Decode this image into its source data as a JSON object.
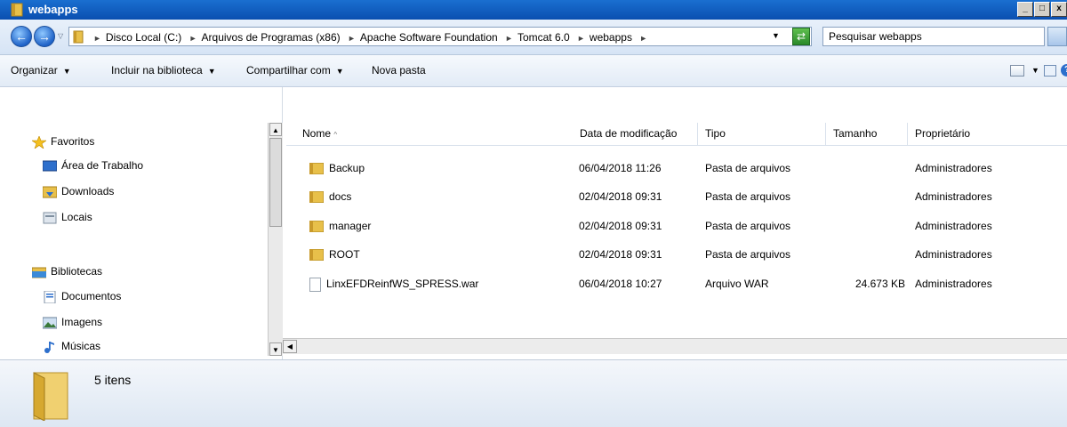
{
  "window": {
    "title": "webapps"
  },
  "address": {
    "crumbs": [
      "Disco Local (C:)",
      "Arquivos de Programas (x86)",
      "Apache Software Foundation",
      "Tomcat 6.0",
      "webapps"
    ],
    "search_placeholder": "Pesquisar webapps"
  },
  "toolbar": {
    "organizar": "Organizar",
    "incluir": "Incluir na biblioteca",
    "compartilhar": "Compartilhar com",
    "nova_pasta": "Nova pasta"
  },
  "nav": {
    "favoritos": "Favoritos",
    "fav_items": [
      "Área de Trabalho",
      "Downloads",
      "Locais"
    ],
    "bibliotecas": "Bibliotecas",
    "lib_items": [
      "Documentos",
      "Imagens",
      "Músicas"
    ]
  },
  "columns": {
    "nome": "Nome",
    "data": "Data de modificação",
    "tipo": "Tipo",
    "tamanho": "Tamanho",
    "proprietario": "Proprietário"
  },
  "files": [
    {
      "name": "Backup",
      "date": "06/04/2018 11:26",
      "type": "Pasta de arquivos",
      "size": "",
      "owner": "Administradores",
      "icon": "folder-icon"
    },
    {
      "name": "docs",
      "date": "02/04/2018 09:31",
      "type": "Pasta de arquivos",
      "size": "",
      "owner": "Administradores",
      "icon": "folder-icon"
    },
    {
      "name": "manager",
      "date": "02/04/2018 09:31",
      "type": "Pasta de arquivos",
      "size": "",
      "owner": "Administradores",
      "icon": "folder-icon"
    },
    {
      "name": "ROOT",
      "date": "02/04/2018 09:31",
      "type": "Pasta de arquivos",
      "size": "",
      "owner": "Administradores",
      "icon": "folder-icon"
    },
    {
      "name": "LinxEFDReinfWS_SPRESS.war",
      "date": "06/04/2018 10:27",
      "type": "Arquivo WAR",
      "size": "24.673 KB",
      "owner": "Administradores",
      "icon": "file-icon"
    }
  ],
  "status": {
    "count": "5 itens"
  },
  "colors": {
    "title_bar": "#0a4fb0",
    "folder": "#e8c04a"
  }
}
